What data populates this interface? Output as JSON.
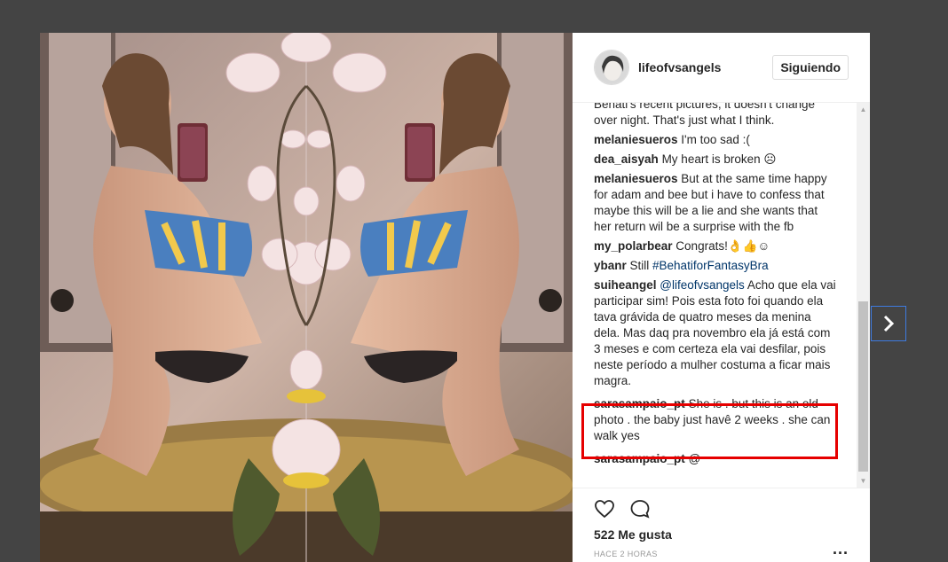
{
  "post": {
    "username": "lifeofvsangels",
    "follow_label": "Siguiendo",
    "likes": "522 Me gusta",
    "time": "HACE 2 HORAS",
    "more_label": "..."
  },
  "comments": [
    {
      "user": "",
      "text": "Behati's recent pictures, it doesn't change over night. That's just what I think."
    },
    {
      "user": "melaniesueros",
      "text": " I'm too sad :("
    },
    {
      "user": "dea_aisyah",
      "text": " My heart is broken ☹"
    },
    {
      "user": "melaniesueros",
      "text": " But at the same time happy for adam and bee but i have to confess that maybe this will be a lie and she wants that her return wil be a surprise with the fb"
    },
    {
      "user": "my_polarbear",
      "text": " Congrats!👌👍☺"
    },
    {
      "user": "ybanr",
      "text": " Still ",
      "link": "#BehatiforFantasyBra"
    },
    {
      "user": "suiheangel",
      "mention": "@lifeofvsangels",
      "text": " Acho que ela vai participar sim! Pois esta foto foi quando ela tava grávida de quatro meses da menina dela. Mas daq pra novembro ela já está com 3 meses e com certeza ela vai desfilar, pois neste período a mulher costuma a ficar mais magra."
    },
    {
      "user": "sarasampaio_pt",
      "text": " She is . but this is an old photo . the baby just havê 2 weeks . she can walk yes"
    },
    {
      "user": "sarasampaio_pt",
      "text": " @"
    }
  ],
  "icons": {
    "like": "heart-icon",
    "comment": "comment-icon",
    "next": "chevron-right-icon"
  },
  "colors": {
    "highlight": "#e60000",
    "link": "#003569",
    "backdrop": "#444444"
  }
}
